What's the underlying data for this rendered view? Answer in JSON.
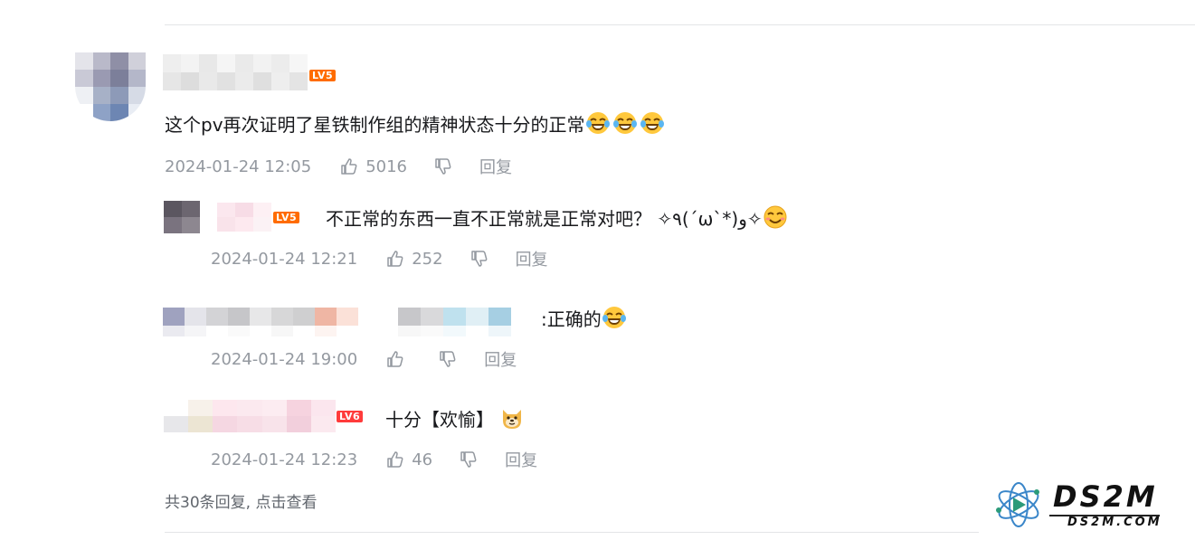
{
  "root_comment": {
    "level": "LV5",
    "text": "这个pv再次证明了星铁制作组的精神状态十分的正常",
    "time": "2024-01-24 12:05",
    "likes": "5016",
    "reply_label": "回复",
    "emojis": [
      "laughing-tears-emoji",
      "laughing-tears-emoji",
      "laughing-tears-emoji"
    ]
  },
  "replies": [
    {
      "level": "LV5",
      "text": "不正常的东西一直不正常就是正常对吧？ ✧٩(ˊωˋ*)و✧",
      "emoji": "blush-smile-emoji",
      "time": "2024-01-24 12:21",
      "likes": "252",
      "reply_label": "回复"
    },
    {
      "text": ":正确的",
      "emoji": "laughing-tears-emoji",
      "time": "2024-01-24 19:00",
      "likes": "",
      "reply_label": "回复"
    },
    {
      "level": "LV6",
      "text": "十分【欢愉】",
      "emoji": "doge-emoji",
      "time": "2024-01-24 12:23",
      "likes": "46",
      "reply_label": "回复"
    }
  ],
  "view_all": "共30条回复, 点击查看",
  "watermark": {
    "title": "DS2M",
    "subtitle": "DS2M.COM"
  },
  "colors": {
    "text": "#18191c",
    "meta": "#9499a0",
    "level5": "#ff6c00",
    "level6": "#ff3b3b",
    "divider": "#e3e5e7"
  }
}
